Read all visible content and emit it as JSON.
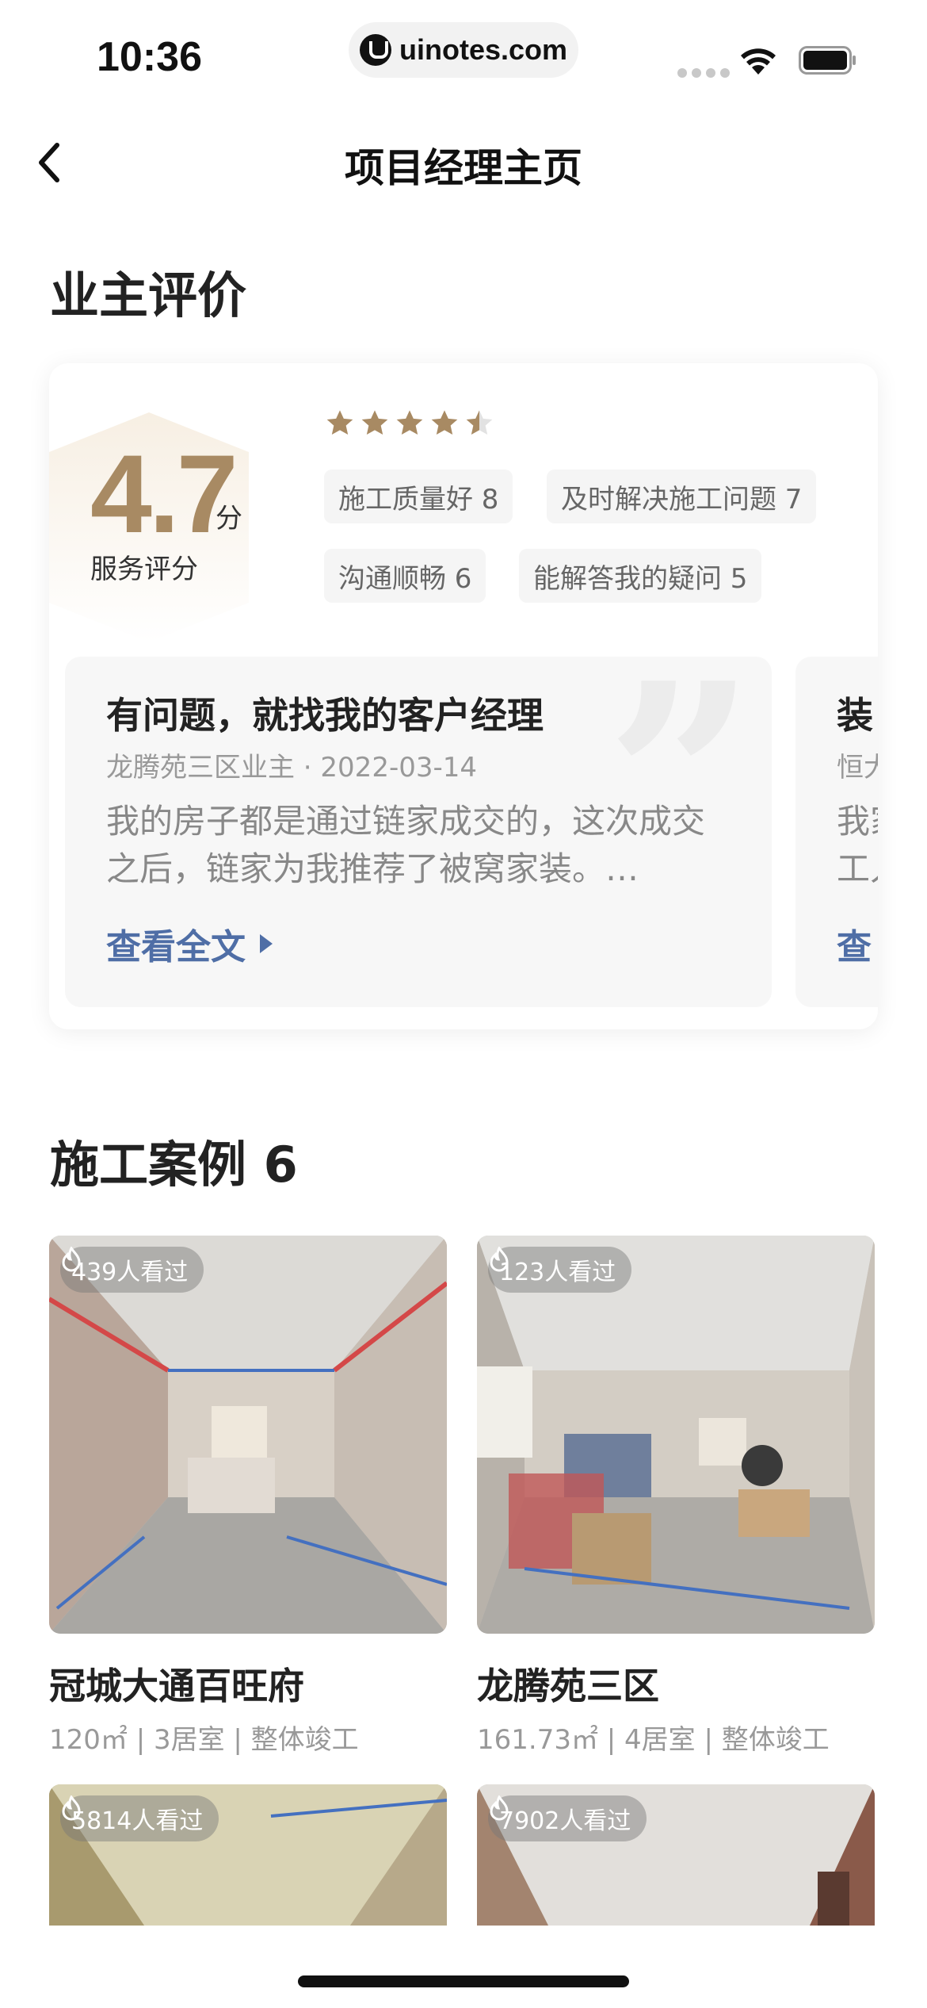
{
  "status_bar": {
    "time": "10:36",
    "url": "uinotes.com"
  },
  "nav": {
    "title": "项目经理主页",
    "back_icon": "chevron-left-icon"
  },
  "reviews": {
    "section_title": "业主评价",
    "score": "4.7",
    "score_unit": "分",
    "score_label": "服务评分",
    "stars": 4.5,
    "star_color": "#a88a63",
    "tags": [
      "施工质量好 8",
      "及时解决施工问题 7",
      "沟通顺畅 6",
      "能解答我的疑问 5"
    ],
    "cards": [
      {
        "title": "有问题，就找我的客户经理",
        "meta": "龙腾苑三区业主 · 2022-03-14",
        "body": "我的房子都是通过链家成交的，这次成交之后，链家为我推荐了被窝家装。…",
        "more": "查看全文"
      },
      {
        "title": "装",
        "meta": "恒大",
        "body": "我家\n工人",
        "more": "查"
      }
    ]
  },
  "cases": {
    "section_title": "施工案例 6",
    "items": [
      {
        "views": "439人看过",
        "name": "冠城大通百旺府",
        "meta": "120㎡ | 3居室 | 整体竣工"
      },
      {
        "views": "123人看过",
        "name": "龙腾苑三区",
        "meta": "161.73㎡ | 4居室 | 整体竣工"
      },
      {
        "views": "5814人看过",
        "name": "",
        "meta": ""
      },
      {
        "views": "7902人看过",
        "name": "",
        "meta": ""
      }
    ]
  },
  "colors": {
    "accent_gold": "#a88a63",
    "link_blue": "#4f6ea6"
  }
}
